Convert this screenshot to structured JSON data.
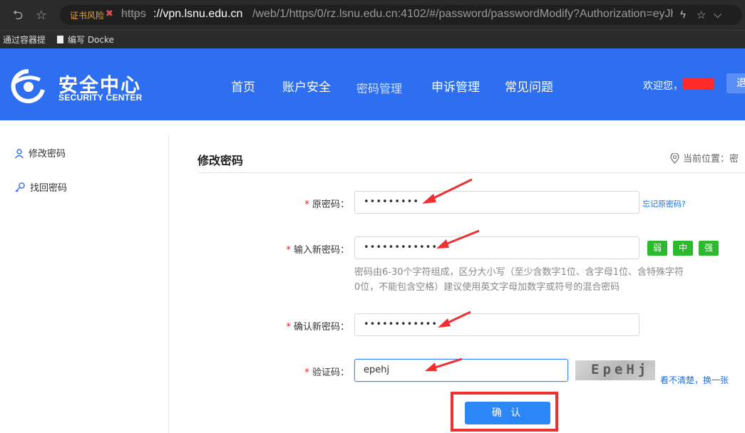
{
  "browser": {
    "cert_warning": "证书风险",
    "url_scheme": "https",
    "url_host": "://vpn.lsnu.edu.cn",
    "url_path": "/web/1/https/0/rz.lsnu.edu.cn:4102/#/password/passwordModify?Authorization=eyJhbGciOi",
    "bookmarks": [
      "通过容器提",
      "编写 Docke"
    ]
  },
  "header": {
    "logo_title": "安全中心",
    "logo_sub": "SECURITY CENTER",
    "nav": [
      "首页",
      "账户安全",
      "密码管理",
      "申诉管理",
      "常见问题"
    ],
    "active_nav": "密码管理",
    "welcome": "欢迎您，",
    "logout_partial": "退"
  },
  "sidebar": {
    "items": [
      {
        "label": "修改密码",
        "icon": "user-icon"
      },
      {
        "label": "找回密码",
        "icon": "key-icon"
      }
    ]
  },
  "main": {
    "title": "修改密码",
    "breadcrumb": "当前位置：密",
    "fields": {
      "old_password": {
        "label": "原密码：",
        "value": "•••••••••",
        "link": "忘记原密码?"
      },
      "new_password": {
        "label": "输入新密码：",
        "value": "••••••••••••"
      },
      "confirm_password": {
        "label": "确认新密码：",
        "value": "••••••••••••"
      },
      "captcha": {
        "label": "验证码：",
        "value": "epehj",
        "refresh_link": "看不清楚，换一张"
      }
    },
    "strength": [
      "弱",
      "中",
      "强"
    ],
    "strength_color": "#2db92d",
    "hint": "密码由6-30个字符组成，区分大小写（至少含数字1位、含字母1位、含特殊字符0位，不能包含空格）建议使用英文字母加数字或符号的混合密码",
    "captcha_image_text": "EpeHj",
    "confirm_button": "确 认"
  },
  "colors": {
    "header_bg": "#2d6ff0",
    "primary_button": "#2d86f5",
    "annotation_red": "#ee3030"
  }
}
